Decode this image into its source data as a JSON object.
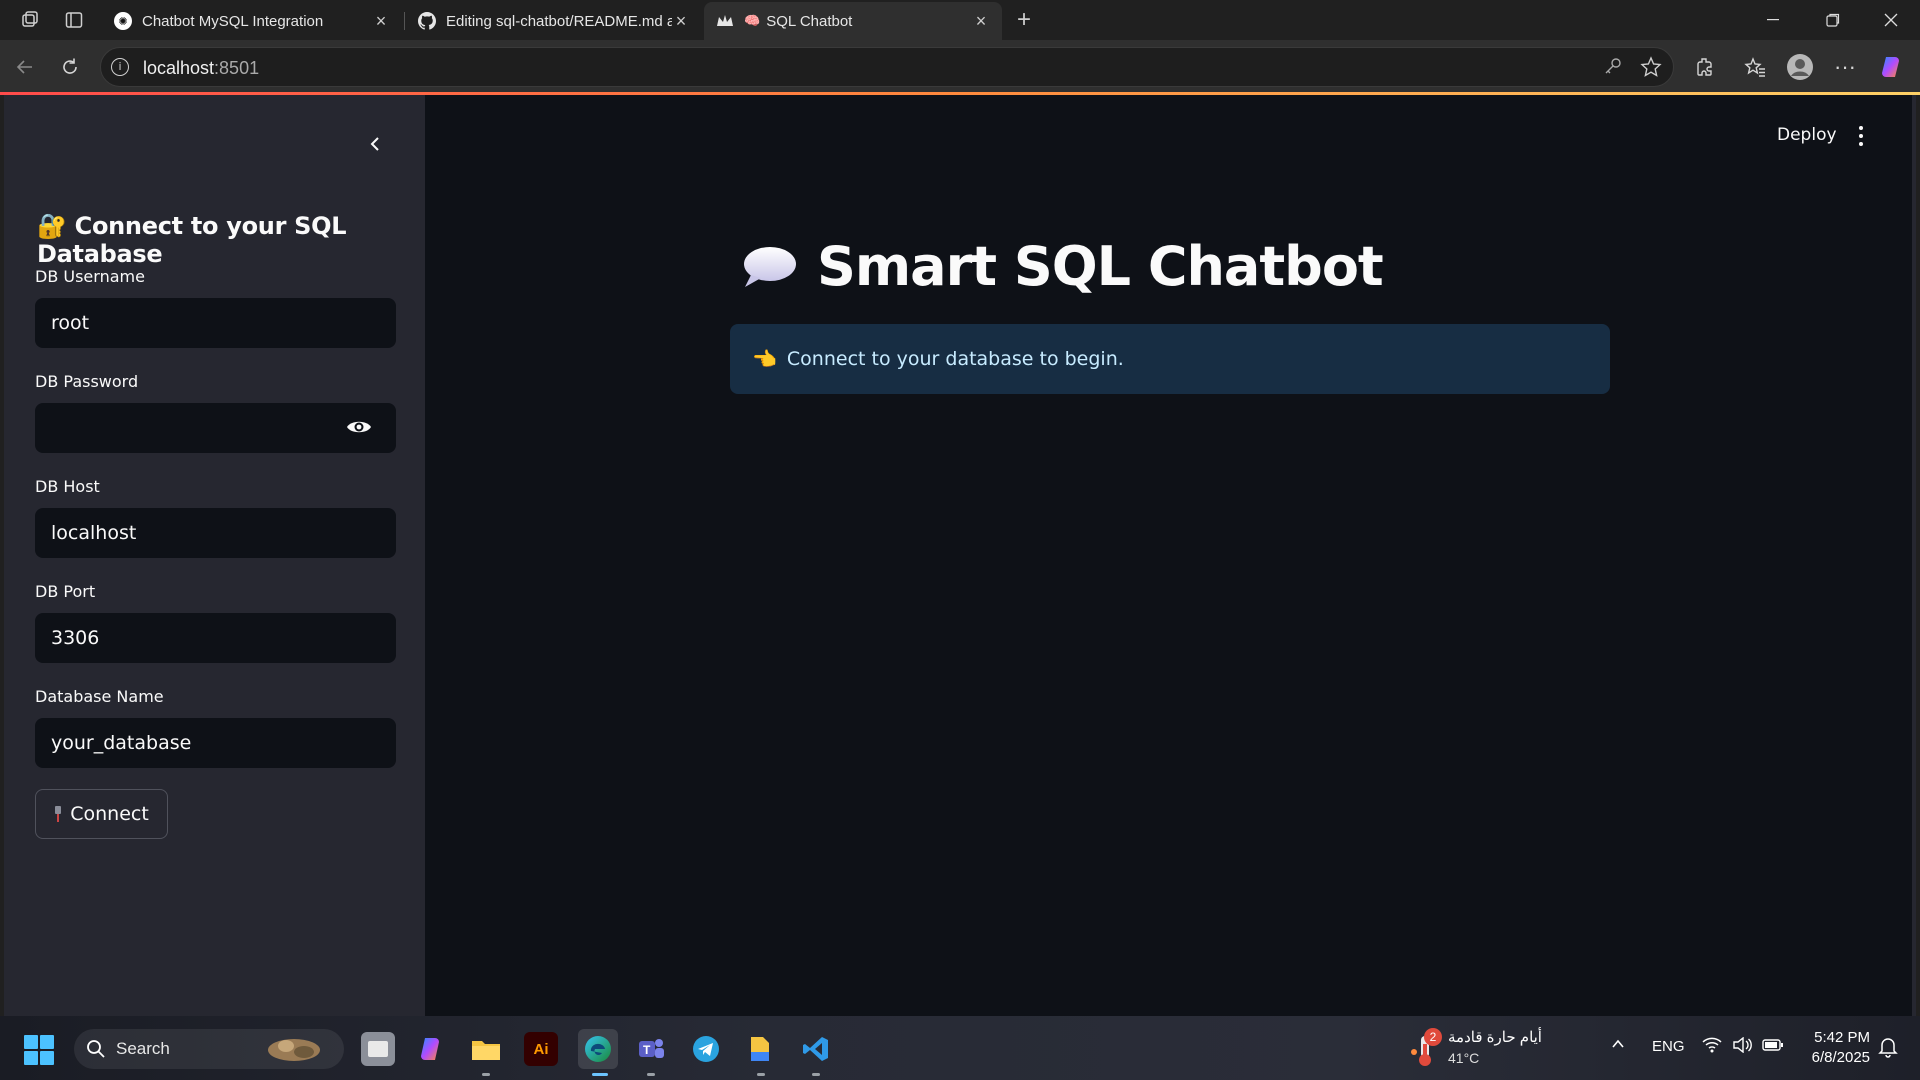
{
  "browser": {
    "tabs": [
      {
        "title": "Chatbot MySQL Integration",
        "active": false
      },
      {
        "title": "Editing sql-chatbot/README.md a",
        "active": false
      },
      {
        "title": "SQL Chatbot",
        "prefix": "🧠",
        "active": true
      }
    ],
    "url_host": "localhost",
    "url_port": ":8501"
  },
  "sidebar": {
    "title": "🔐 Connect to your SQL Database",
    "fields": {
      "username": {
        "label": "DB Username",
        "value": "root"
      },
      "password": {
        "label": "DB Password",
        "value": ""
      },
      "host": {
        "label": "DB Host",
        "value": "localhost"
      },
      "port": {
        "label": "DB Port",
        "value": "3306"
      },
      "database": {
        "label": "Database Name",
        "value": "your_database"
      }
    },
    "connect_label": "Connect"
  },
  "main": {
    "deploy_label": "Deploy",
    "heading": "Smart SQL Chatbot",
    "info_text": "Connect to your database to begin.",
    "info_emoji": "👈"
  },
  "taskbar": {
    "search_label": "Search",
    "weather_text": "أيام حارة قادمة",
    "weather_temp": "41°C",
    "weather_badge": "2",
    "language": "ENG",
    "time": "5:42 PM",
    "date": "6/8/2025"
  },
  "colors": {
    "app_bg": "#0e1117",
    "sidebar_bg": "#262730",
    "info_bg": "#172d43",
    "info_text": "#c7ebff",
    "accent": "#ff4b4b"
  }
}
